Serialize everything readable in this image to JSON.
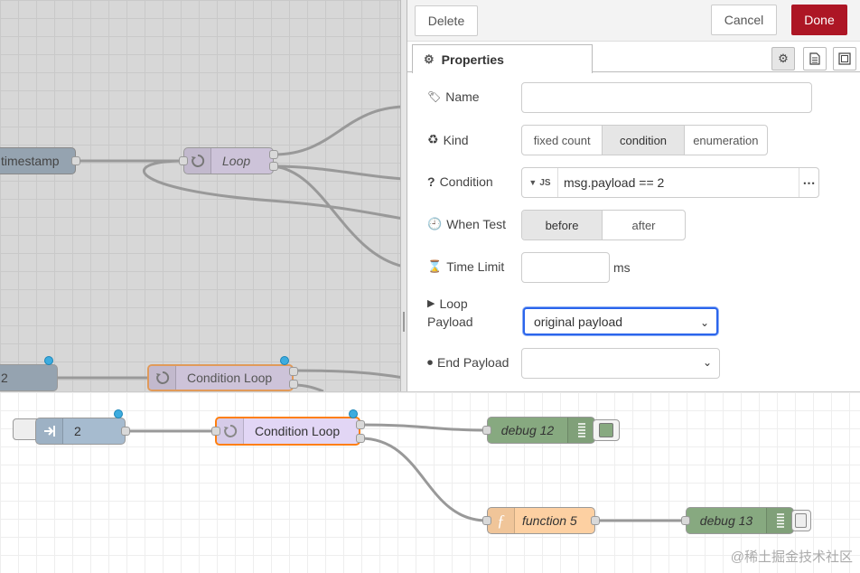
{
  "toolbar": {
    "delete_label": "Delete",
    "cancel_label": "Cancel",
    "done_label": "Done"
  },
  "tabs": {
    "properties_label": "Properties"
  },
  "form": {
    "name_label": "Name",
    "name_value": "",
    "kind_label": "Kind",
    "kind_options": [
      "fixed count",
      "condition",
      "enumeration"
    ],
    "kind_selected": "condition",
    "condition_label": "Condition",
    "condition_type": "JS",
    "condition_value": "msg.payload == 2",
    "when_label": "When Test",
    "when_options": [
      "before",
      "after"
    ],
    "when_selected": "before",
    "time_limit_label": "Time Limit",
    "time_limit_unit": "ms",
    "loop_payload_label_1": "Loop",
    "loop_payload_label_2": "Payload",
    "loop_payload_value": "original payload",
    "end_payload_label": "End Payload",
    "end_payload_value": ""
  },
  "top_flow": {
    "timestamp_label": "timestamp",
    "loop_label": "Loop",
    "inject_label": "2",
    "condition_loop_label": "Condition Loop"
  },
  "bottom_flow": {
    "inject_label": "2",
    "condition_loop_label": "Condition Loop",
    "debug12_label": "debug 12",
    "function5_label": "function 5",
    "debug13_label": "debug 13"
  },
  "watermark": "@稀土掘金技术社区",
  "colors": {
    "inject": "#a6bbcf",
    "loop": "#e2d6f5",
    "debug": "#87a980",
    "function": "#fdd0a2",
    "done": "#ad1625",
    "selected_border": "#ff7f0e"
  }
}
